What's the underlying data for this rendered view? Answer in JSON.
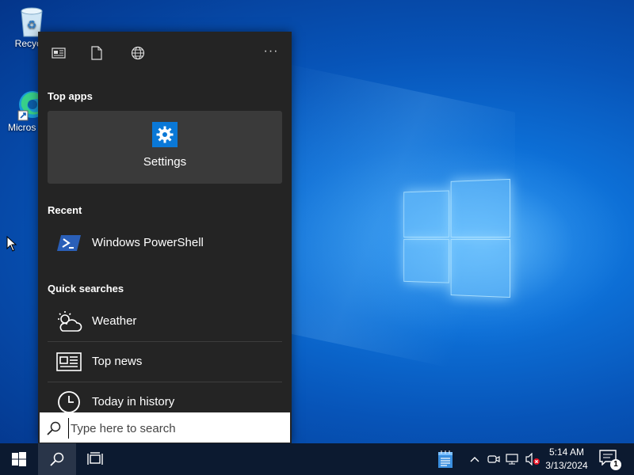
{
  "desktop": {
    "icons": [
      {
        "label": "Recycle",
        "icon": "recycle-bin-icon"
      },
      {
        "label": "Micros Edg",
        "icon": "edge-icon"
      }
    ]
  },
  "search_panel": {
    "toolbar": {
      "news_icon": "news-icon",
      "documents_icon": "document-icon",
      "web_icon": "globe-icon",
      "more_label": "···"
    },
    "top_apps_heading": "Top apps",
    "top_apps": [
      {
        "label": "Settings",
        "icon": "settings-gear-icon"
      }
    ],
    "recent_heading": "Recent",
    "recent": [
      {
        "label": "Windows PowerShell",
        "icon": "powershell-icon"
      }
    ],
    "quick_searches_heading": "Quick searches",
    "quick_searches": [
      {
        "label": "Weather",
        "icon": "weather-icon"
      },
      {
        "label": "Top news",
        "icon": "newspaper-icon"
      },
      {
        "label": "Today in history",
        "icon": "clock-icon"
      }
    ]
  },
  "search_box": {
    "placeholder": "Type here to search",
    "value": ""
  },
  "taskbar": {
    "clock_time": "5:14 AM",
    "clock_date": "3/13/2024",
    "notification_count": "1",
    "accent": "#0a78d7"
  }
}
